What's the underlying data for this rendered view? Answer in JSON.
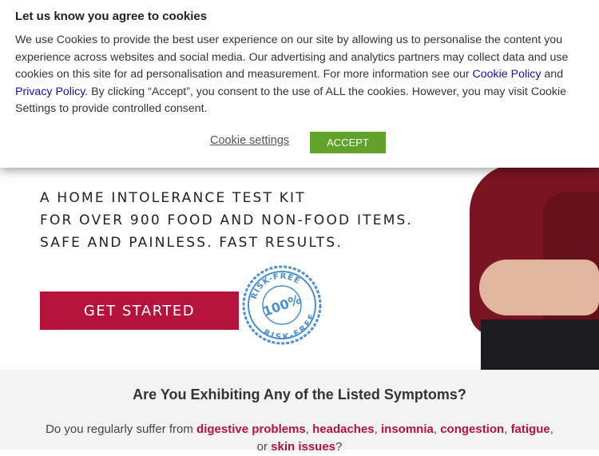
{
  "cookie": {
    "title": "Let us know you agree to cookies",
    "text_1": "We use Cookies to provide the best user experience on our site by allowing us to personalise the content you experience across websites and social media. Our advertising and analytics partners may collect data and use cookies on this site for ad personalisation and measurement. For more information see our ",
    "cookie_policy_link": "Cookie Policy",
    "text_and": " and ",
    "privacy_policy_link": "Privacy Policy",
    "text_2": ". By clicking “Accept”, you consent to the use of ALL the cookies. However, you may visit Cookie Settings to provide controlled consent.",
    "settings_label": "Cookie settings",
    "accept_label": "ACCEPT",
    "accept_color": "#61a229"
  },
  "hero": {
    "lines": [
      "A HOME INTOLERANCE TEST KIT",
      "FOR OVER 900 FOOD AND NON-FOOD ITEMS.",
      "SAFE AND PAINLESS. FAST RESULTS."
    ],
    "cta_label": "GET STARTED",
    "cta_color": "#b5123c",
    "badge": {
      "top": "RISK-FREE",
      "center": "100%",
      "bottom": "RISK-FREE",
      "color": "#4a8fcf"
    }
  },
  "symptoms": {
    "heading": "Are You Exhibiting Any of the Listed Symptoms?",
    "prefix": "Do you regularly suffer from ",
    "items": [
      "digestive problems",
      "headaches",
      "insomnia",
      "congestion",
      "fatigue"
    ],
    "sep": ", ",
    "or": ", or ",
    "last_item": "skin issues",
    "suffix": "?"
  }
}
